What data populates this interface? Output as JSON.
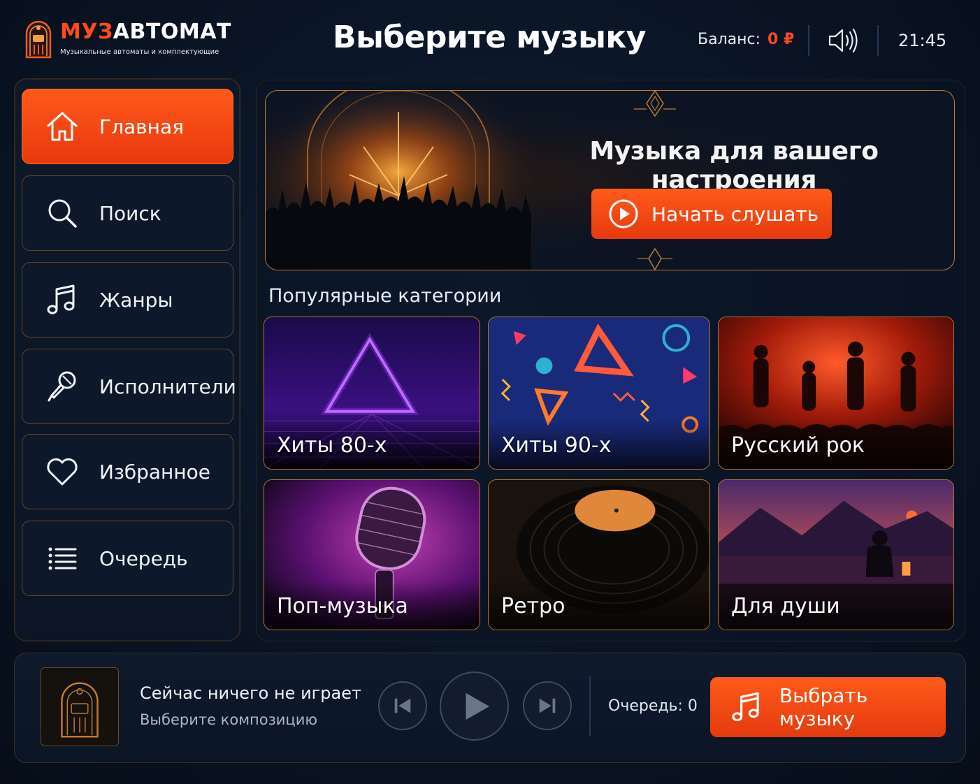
{
  "header": {
    "brand_part1": "МУЗ",
    "brand_part2": "АВТОМАТ",
    "brand_subtitle": "Музыкальные автоматы и комплектующие",
    "page_title": "Выберите музыку",
    "balance_label": "Баланс:",
    "balance_value": "0 ₽",
    "time": "21:45",
    "volume_icon": "speaker-volume-icon"
  },
  "sidebar": {
    "items": [
      {
        "label": "Главная",
        "icon": "home-icon",
        "active": true
      },
      {
        "label": "Поиск",
        "icon": "search-icon",
        "active": false
      },
      {
        "label": "Жанры",
        "icon": "music-note-icon",
        "active": false
      },
      {
        "label": "Исполнители",
        "icon": "microphone-icon",
        "active": false
      },
      {
        "label": "Избранное",
        "icon": "heart-icon",
        "active": false
      },
      {
        "label": "Очередь",
        "icon": "list-icon",
        "active": false
      }
    ]
  },
  "hero": {
    "title": "Музыка для вашего настроения",
    "button_label": "Начать слушать"
  },
  "categories": {
    "title": "Популярные категории",
    "items": [
      {
        "label": "Хиты 80-х"
      },
      {
        "label": "Хиты 90-х"
      },
      {
        "label": "Русский рок"
      },
      {
        "label": "Поп-музыка"
      },
      {
        "label": "Ретро"
      },
      {
        "label": "Для души"
      }
    ]
  },
  "player": {
    "now_playing_title": "Сейчас ничего не играет",
    "now_playing_subtitle": "Выберите композицию",
    "queue_label": "Очередь: 0",
    "choose_button": "Выбрать музыку"
  },
  "colors": {
    "accent": "#ff4a1a",
    "background": "#0a1424",
    "border_gold": "#c07a30"
  }
}
